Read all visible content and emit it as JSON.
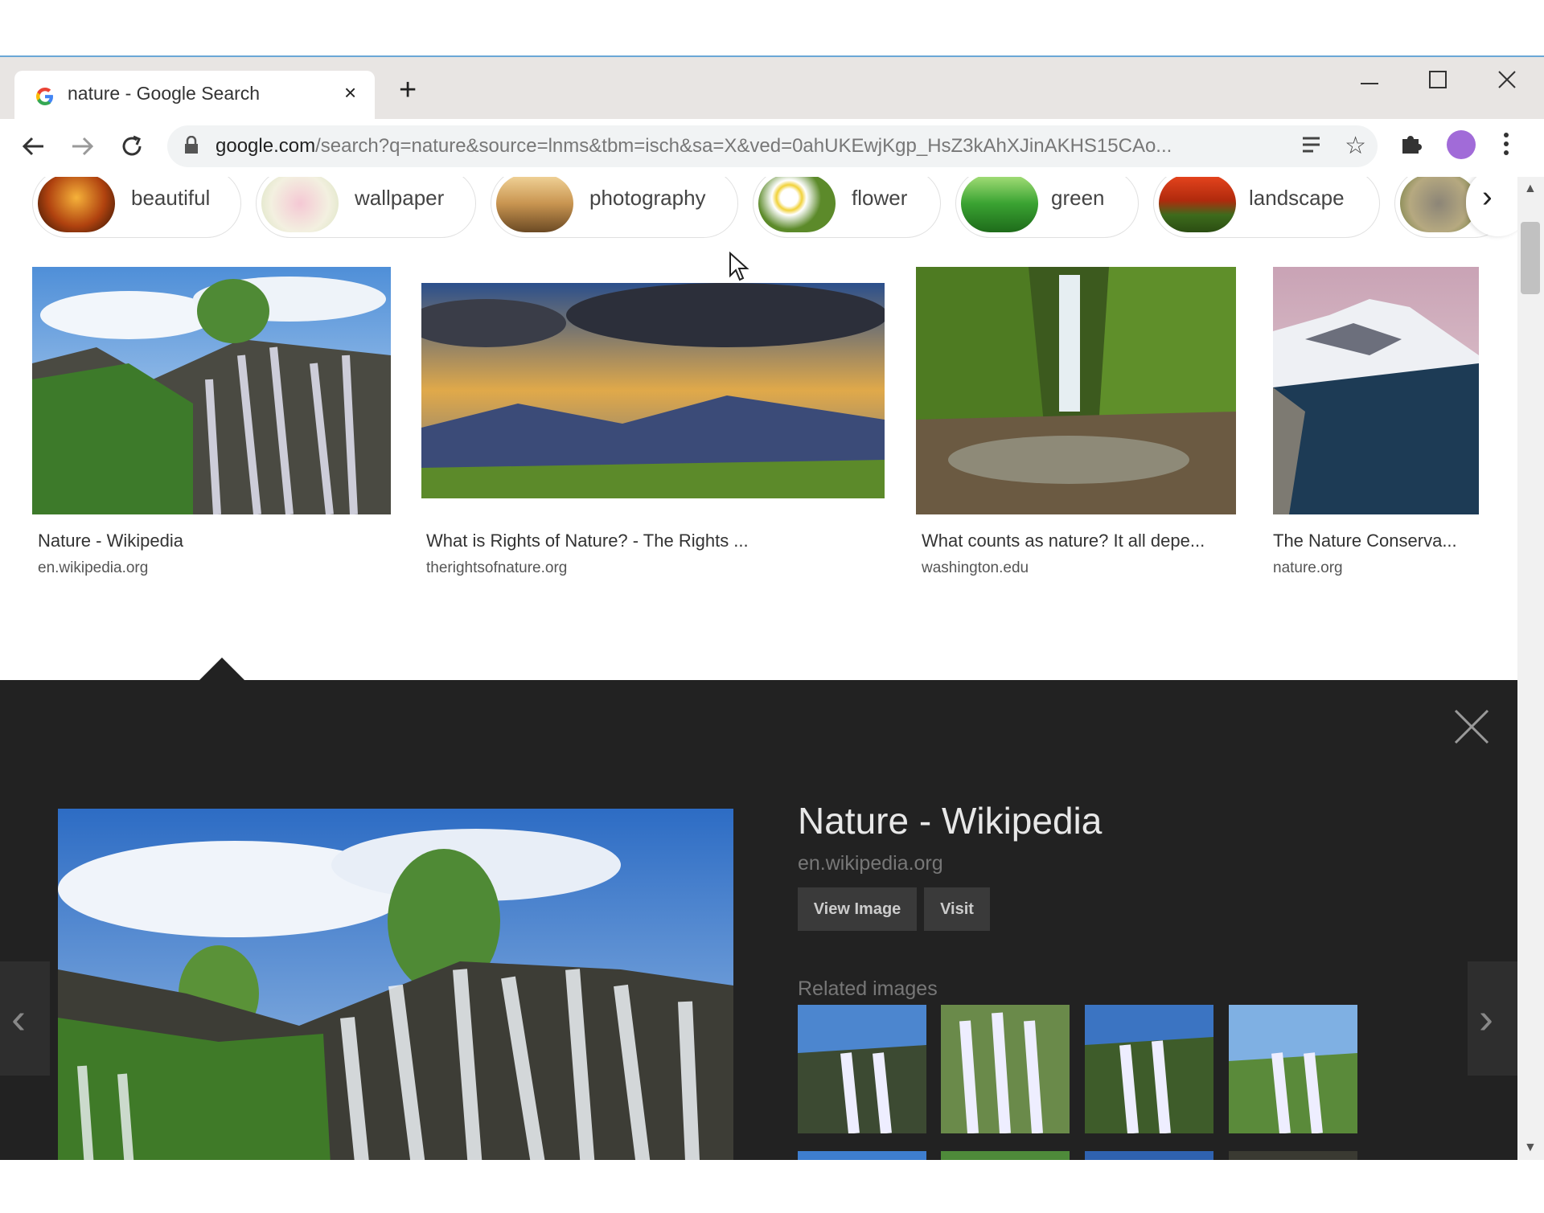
{
  "browser": {
    "tab_title": "nature - Google Search",
    "tab_close": "×",
    "new_tab": "+",
    "url_domain": "google.com",
    "url_path": "/search?q=nature&source=lnms&tbm=isch&sa=X&ved=0ahUKEwjKgp_HsZ3kAhXJinAKHS15CAo..."
  },
  "chips": [
    {
      "label": "beautiful"
    },
    {
      "label": "wallpaper"
    },
    {
      "label": "photography"
    },
    {
      "label": "flower"
    },
    {
      "label": "green"
    },
    {
      "label": "landscape"
    }
  ],
  "results": [
    {
      "title": "Nature - Wikipedia",
      "source": "en.wikipedia.org"
    },
    {
      "title": "What is Rights of Nature? - The Rights ...",
      "source": "therightsofnature.org"
    },
    {
      "title": "What counts as nature? It all depe...",
      "source": "washington.edu"
    },
    {
      "title": "The Nature Conserva...",
      "source": "nature.org"
    }
  ],
  "preview": {
    "title": "Nature - Wikipedia",
    "source": "en.wikipedia.org",
    "view_image": "View Image",
    "visit": "Visit",
    "related_label": "Related images"
  },
  "colors": {
    "preview_bg": "#222222",
    "avatar": "#a16bd8"
  }
}
